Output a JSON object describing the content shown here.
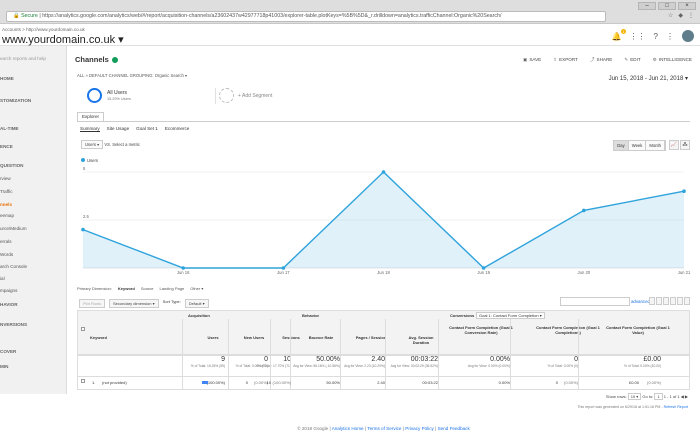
{
  "browser": {
    "secure_label": "Secure",
    "url": "https://analytics.google.com/analytics/web/#/report/acquisition-channels/a23602437w42977718p41003/explorer-table.plotKeys=%5B%5D&_r.drilldown=analytics.trafficChannel:Organic%20Search/"
  },
  "header": {
    "account_small": "Accounts > http://www.yourdomain.co.uk",
    "account_big": "www.yourdomain.co.uk",
    "notification_count": "1"
  },
  "sidebar": {
    "search_placeholder": "earch reports and help",
    "items": [
      {
        "label": "HOME",
        "kind": "section"
      },
      {
        "label": "STOMIZATION",
        "kind": "section"
      },
      {
        "label": "AL-TIME",
        "kind": "section"
      },
      {
        "label": "ENCE",
        "kind": "section"
      },
      {
        "label": "QUISITION",
        "kind": "section"
      },
      {
        "label": "rview",
        "kind": "item"
      },
      {
        "label": "Traffic",
        "kind": "item"
      },
      {
        "label": "nnels",
        "kind": "active"
      },
      {
        "label": "eemap",
        "kind": "item"
      },
      {
        "label": "urce/Medium",
        "kind": "item"
      },
      {
        "label": "errals",
        "kind": "item"
      },
      {
        "label": "Words",
        "kind": "item"
      },
      {
        "label": "arch Console",
        "kind": "item"
      },
      {
        "label": "ial",
        "kind": "item"
      },
      {
        "label": "mpaigns",
        "kind": "item"
      },
      {
        "label": "HAVIOR",
        "kind": "section"
      },
      {
        "label": "NVERSIONS",
        "kind": "section"
      },
      {
        "label": "COVER",
        "kind": "section"
      },
      {
        "label": "MIN",
        "kind": "section"
      }
    ]
  },
  "main": {
    "title": "Channels",
    "actions": [
      {
        "icon": "save-icon",
        "glyph": "▣",
        "label": "SAVE"
      },
      {
        "icon": "export-icon",
        "glyph": "⇪",
        "label": "EXPORT"
      },
      {
        "icon": "share-icon",
        "glyph": "⤴",
        "label": "SHARE"
      },
      {
        "icon": "edit-icon",
        "glyph": "✎",
        "label": "EDIT"
      },
      {
        "icon": "insights-icon",
        "glyph": "⚙",
        "label": "INTELLIGENCE"
      }
    ],
    "breadcrumb": "ALL  »  DEFAULT CHANNEL GROUPING: Organic Search  ▾",
    "date_range": "Jun 15, 2018 - Jun 21, 2018  ▾",
    "segment": {
      "name": "All Users",
      "sub": "15.29% Users"
    },
    "add_segment": "+ Add Segment",
    "explorer_tab": "Explorer",
    "subtabs": [
      "Summary",
      "Site Usage",
      "Goal Set 1",
      "Ecommerce"
    ],
    "metric": {
      "primary": "Users  ▾",
      "vs": "VS.",
      "select": "Select a metric"
    },
    "granularity": [
      "Day",
      "Week",
      "Month"
    ],
    "legend": "Users"
  },
  "chart_data": {
    "type": "area",
    "x": [
      "Jun 15",
      "Jun 16",
      "Jun 17",
      "Jun 18",
      "Jun 19",
      "Jun 20",
      "Jun 21"
    ],
    "x_tick_labels": [
      "Jun 16",
      "Jun 17",
      "Jun 18",
      "Jun 19",
      "Jun 20",
      "Jun 21"
    ],
    "series": [
      {
        "name": "Users",
        "values": [
          2,
          0,
          0,
          5,
          0,
          3,
          4
        ]
      }
    ],
    "ylim": [
      0,
      5
    ],
    "y_ticks": [
      "5",
      "2.5"
    ],
    "grid": true,
    "color": "#2ea3dc"
  },
  "table": {
    "dimension_row": {
      "label": "Primary Dimension:",
      "items": [
        "Keyword",
        "Source",
        "Landing Page",
        "Other  ▾"
      ]
    },
    "controls": {
      "plot": "Plot Rows",
      "secondary": "Secondary dimension  ▾",
      "sort": "Sort Type:",
      "sort_value": "Default  ▾"
    },
    "advanced": "advanced",
    "group_headers": {
      "acquisition": "Acquisition",
      "behavior": "Behavior",
      "conversions": "Conversions",
      "goal": "Goal 1: Contact Form Completion  ▾"
    },
    "columns": [
      {
        "label": "Keyword"
      },
      {
        "label": "Users",
        "total": "9",
        "sub": "% of Total: 15.25% (59)"
      },
      {
        "label": "New Users",
        "total": "0",
        "sub": "% of Total: 0.00% (57)"
      },
      {
        "label": "Sessions",
        "total": "10",
        "sub": "% of Total: 17.70% (71)"
      },
      {
        "label": "Bounce Rate",
        "total": "50.00%",
        "sub": "Avg for View: 56.16% (-10.96%)"
      },
      {
        "label": "Pages / Session",
        "total": "2.40",
        "sub": "Avg for View: 2.23 (10.20%)"
      },
      {
        "label": "Avg. Session Duration",
        "total": "00:03:22",
        "sub": "Avg for View: 00:02:29 (35.52%)"
      },
      {
        "label": "Contact Form Completion (Goal 1 Conversion Rate)",
        "total": "0.00%",
        "sub": "Avg for View: 0.00% (0.00%)"
      },
      {
        "label": "Contact Form Completion (Goal 1 Completions)",
        "total": "0",
        "sub": "% of Total: 0.00% (0)"
      },
      {
        "label": "Contact Form Completion (Goal 1 Value)",
        "total": "£0.00",
        "sub": "% of Total: 0.00% (£0.00)"
      }
    ],
    "row": {
      "index": "1.",
      "keyword": "(not provided)",
      "users": "9(100.00%)",
      "new_users": "0",
      "new_users_pct": "(0.00%)",
      "sessions": "10",
      "sessions_pct": "(100.00%)",
      "bounce": "50.00%",
      "pages": "2.40",
      "duration": "00:03:22",
      "conv_rate": "0.00%",
      "completions": "0",
      "completions_pct": "(0.00%)",
      "value": "£0.00",
      "value_pct": "(0.00%)"
    },
    "pager": {
      "show_rows": "Show rows:",
      "rows": "10 ▾",
      "goto": "Go to:",
      "page": "1",
      "range": "1 - 1 of 1"
    },
    "generated": "This report was generated on 6/29/18 at 1:51:16 PM -",
    "refresh": "Refresh Report"
  },
  "footer": {
    "copyright": "© 2018 Google | ",
    "links": [
      "Analytics Home",
      "Terms of Service",
      "Privacy Policy",
      "Send Feedback"
    ]
  }
}
